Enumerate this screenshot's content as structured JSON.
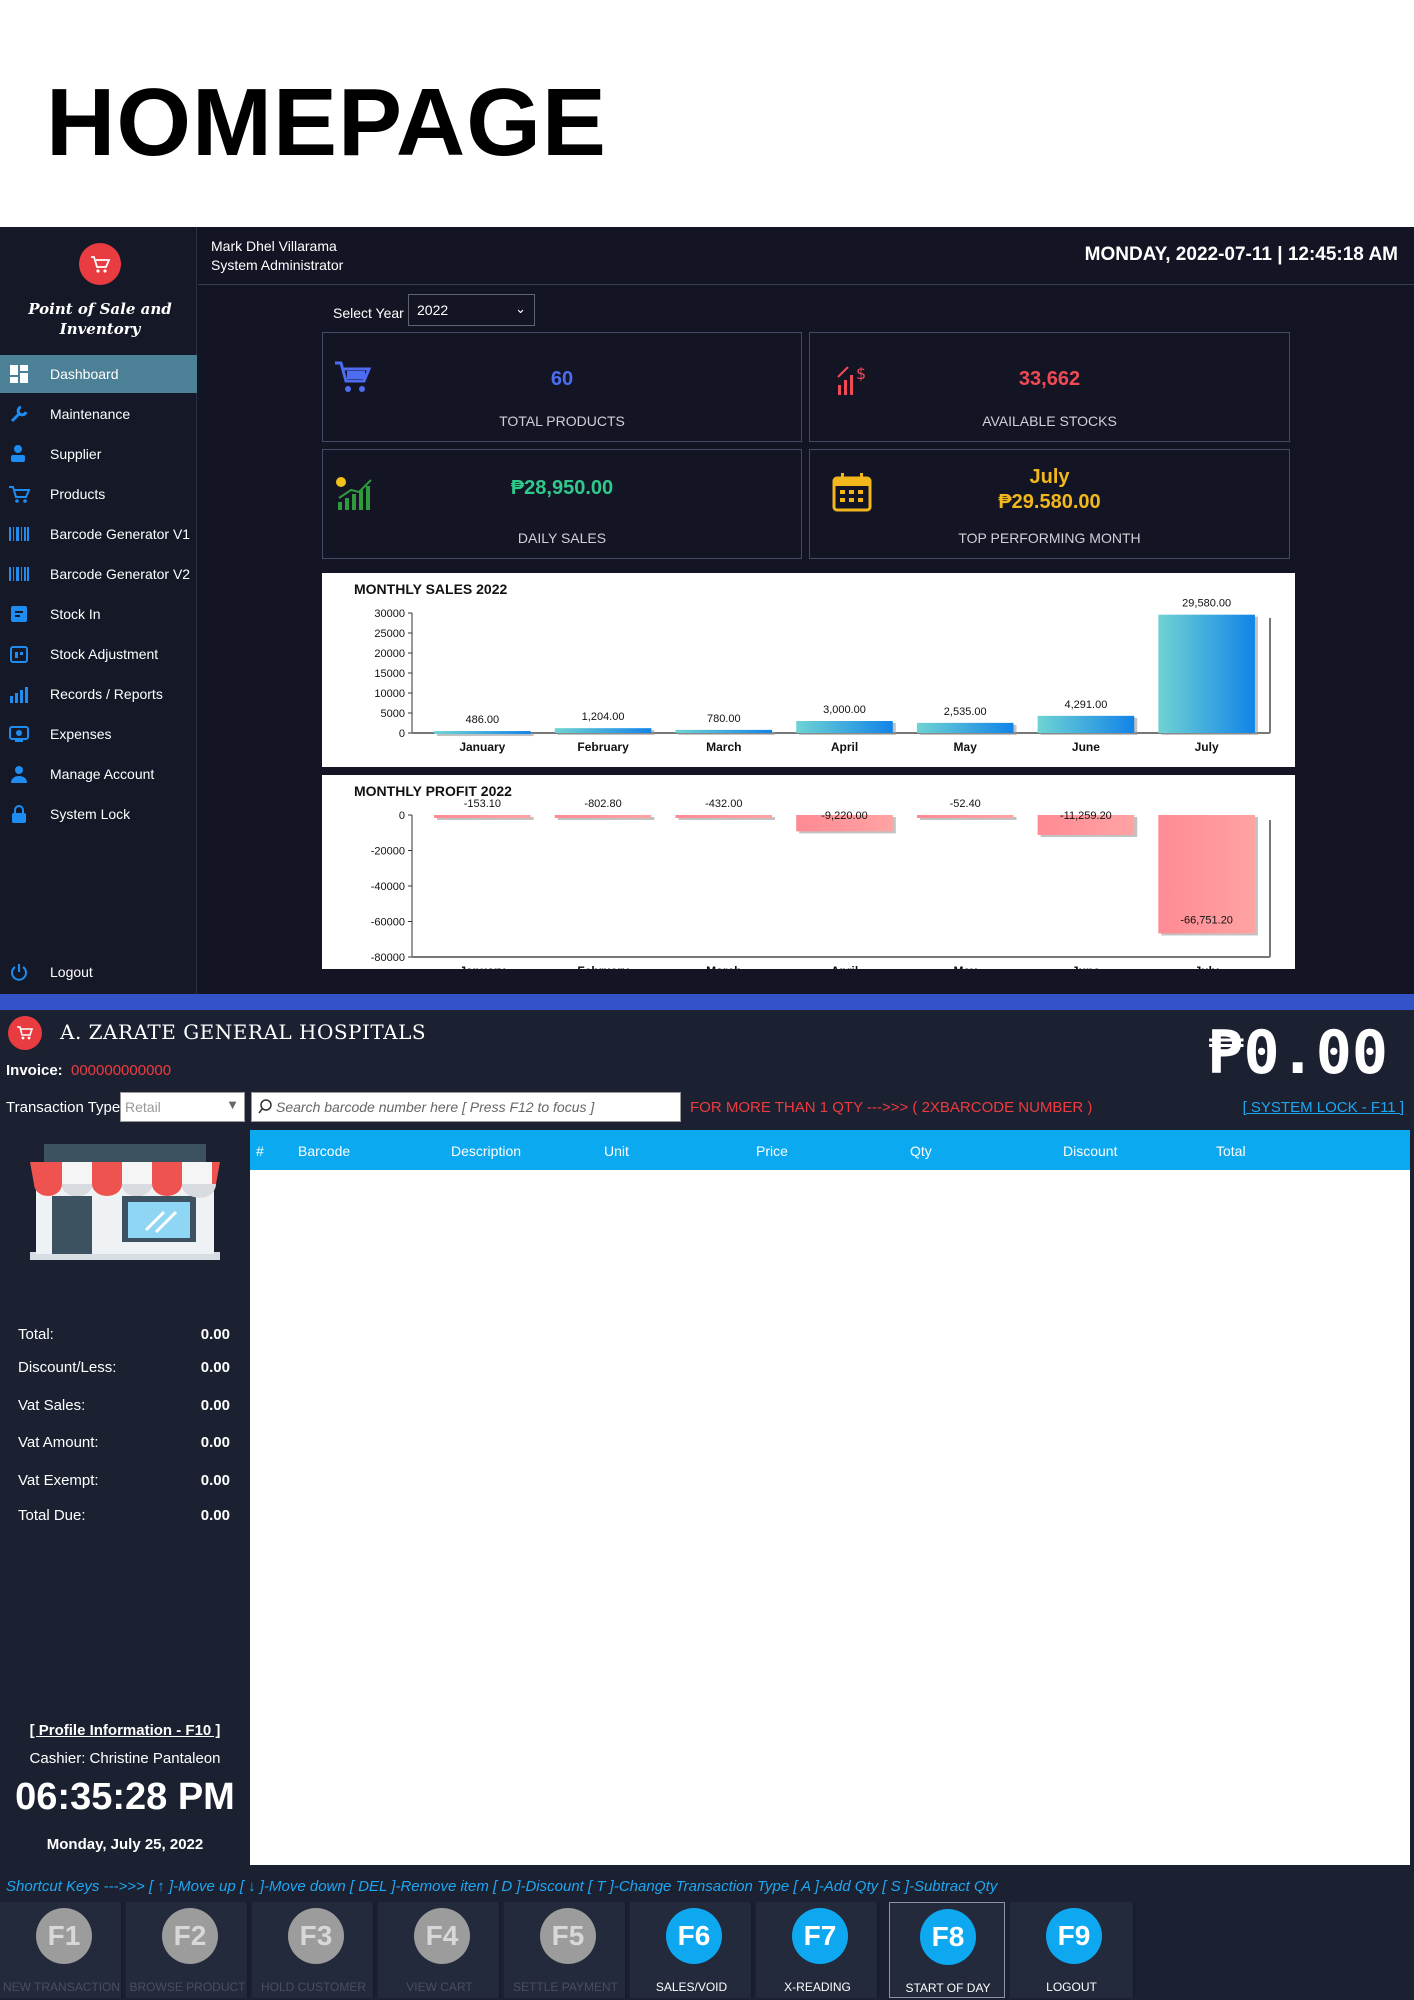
{
  "page_title": "HOMEPAGE",
  "dashboard": {
    "app_name_line1": "Point of Sale and",
    "app_name_line2": "Inventory",
    "nav": [
      {
        "label": "Dashboard",
        "icon": "dashboard-icon",
        "active": true
      },
      {
        "label": "Maintenance",
        "icon": "wrench-icon"
      },
      {
        "label": "Supplier",
        "icon": "supplier-icon"
      },
      {
        "label": "Products",
        "icon": "cart-icon"
      },
      {
        "label": "Barcode Generator V1",
        "icon": "barcode-icon"
      },
      {
        "label": "Barcode Generator V2",
        "icon": "barcode-icon"
      },
      {
        "label": "Stock In",
        "icon": "stock-in-icon"
      },
      {
        "label": "Stock Adjustment",
        "icon": "adjustment-icon"
      },
      {
        "label": "Records / Reports",
        "icon": "reports-icon"
      },
      {
        "label": "Expenses",
        "icon": "expenses-icon"
      },
      {
        "label": "Manage Account",
        "icon": "user-icon"
      },
      {
        "label": "System Lock",
        "icon": "lock-icon"
      }
    ],
    "logout": "Logout",
    "user_name": "Mark Dhel Villarama",
    "user_role": "System Administrator",
    "datetime": "MONDAY, 2022-07-11 | 12:45:18 AM",
    "select_year_label": "Select Year",
    "selected_year": "2022",
    "cards": {
      "total_products": {
        "value": "60",
        "label": "TOTAL PRODUCTS",
        "color": "#4d6cf1"
      },
      "available_stocks": {
        "value": "33,662",
        "label": "AVAILABLE STOCKS",
        "color": "#f04a54"
      },
      "daily_sales": {
        "value": "₱28,950.00",
        "label": "DAILY SALES",
        "color": "#2fc98c"
      },
      "top_month": {
        "month": "July",
        "value": "₱29.580.00",
        "label": "TOP PERFORMING MONTH",
        "color": "#f2b81b"
      }
    }
  },
  "chart_data": [
    {
      "type": "bar",
      "title": "MONTHLY SALES 2022",
      "categories": [
        "January",
        "February",
        "March",
        "April",
        "May",
        "June",
        "July"
      ],
      "values": [
        486,
        1204,
        780,
        3000,
        2535,
        4291,
        29580
      ],
      "value_labels": [
        "486.00",
        "1,204.00",
        "780.00",
        "3,000.00",
        "2,535.00",
        "4,291.00",
        "29,580.00"
      ],
      "ylim": [
        0,
        30000
      ],
      "yticks": [
        0,
        5000,
        10000,
        15000,
        20000,
        25000,
        30000
      ],
      "grid": false,
      "color_from": "#6fd3d3",
      "color_to": "#1184e8"
    },
    {
      "type": "bar",
      "title": "MONTHLY PROFIT 2022",
      "categories": [
        "January",
        "February",
        "March",
        "April",
        "May",
        "June",
        "July"
      ],
      "values": [
        -153.1,
        -802.8,
        -432.0,
        -9220.0,
        -52.4,
        -11259.2,
        -66751.2
      ],
      "value_labels": [
        "-153.10",
        "-802.80",
        "-432.00",
        "-9,220.00",
        "-52.40",
        "-11,259.20",
        "-66,751.20"
      ],
      "ylim": [
        -80000,
        0
      ],
      "yticks": [
        0,
        -20000,
        -40000,
        -60000,
        -80000
      ],
      "grid": false,
      "color_from": "#ff8a93",
      "color_to": "#ffa3a3"
    }
  ],
  "pos": {
    "hospital_name": "A. ZARATE GENERAL HOSPITALS",
    "big_total": "₱0.00",
    "invoice_label": "Invoice:",
    "invoice_value": "000000000000",
    "transaction_type_label": "Transaction Type:",
    "transaction_type_value": "Retail",
    "search_placeholder": "Search barcode number here [ Press F12 to focus ]",
    "qty_hint": "FOR MORE THAN 1 QTY --->>> ( 2XBARCODE NUMBER )",
    "system_lock_link": "[ SYSTEM LOCK - F11 ]",
    "columns": [
      "#",
      "Barcode",
      "Description",
      "Unit",
      "Price",
      "Qty",
      "Discount",
      "Total"
    ],
    "summary": [
      {
        "label": "Total:",
        "value": "0.00"
      },
      {
        "label": "Discount/Less:",
        "value": "0.00"
      },
      {
        "label": "Vat Sales:",
        "value": "0.00"
      },
      {
        "label": "Vat Amount:",
        "value": "0.00"
      },
      {
        "label": "Vat Exempt:",
        "value": "0.00"
      },
      {
        "label": "Total Due:",
        "value": "0.00"
      }
    ],
    "profile_link": "[ Profile Information - F10 ]",
    "cashier": "Cashier: Christine Pantaleon",
    "clock": "06:35:28 PM",
    "date": "Monday, July 25, 2022",
    "shortcuts": "Shortcut Keys --->>>  [ ↑ ]-Move up [ ↓ ]-Move down  [ DEL ]-Remove item [ D ]-Discount [ T ]-Change Transaction Type [ A ]-Add Qty [ S ]-Subtract Qty",
    "fkeys": [
      {
        "key": "F1",
        "label": "NEW TRANSACTION",
        "enabled": false
      },
      {
        "key": "F2",
        "label": "BROWSE PRODUCT",
        "enabled": false
      },
      {
        "key": "F3",
        "label": "HOLD CUSTOMER",
        "enabled": false
      },
      {
        "key": "F4",
        "label": "VIEW CART",
        "enabled": false
      },
      {
        "key": "F5",
        "label": "SETTLE PAYMENT",
        "enabled": false
      },
      {
        "key": "F6",
        "label": "SALES/VOID",
        "enabled": true
      },
      {
        "key": "F7",
        "label": "X-READING",
        "enabled": true
      },
      {
        "key": "F8",
        "label": "START OF DAY",
        "enabled": true,
        "selected": true
      },
      {
        "key": "F9",
        "label": "LOGOUT",
        "enabled": true
      }
    ]
  }
}
